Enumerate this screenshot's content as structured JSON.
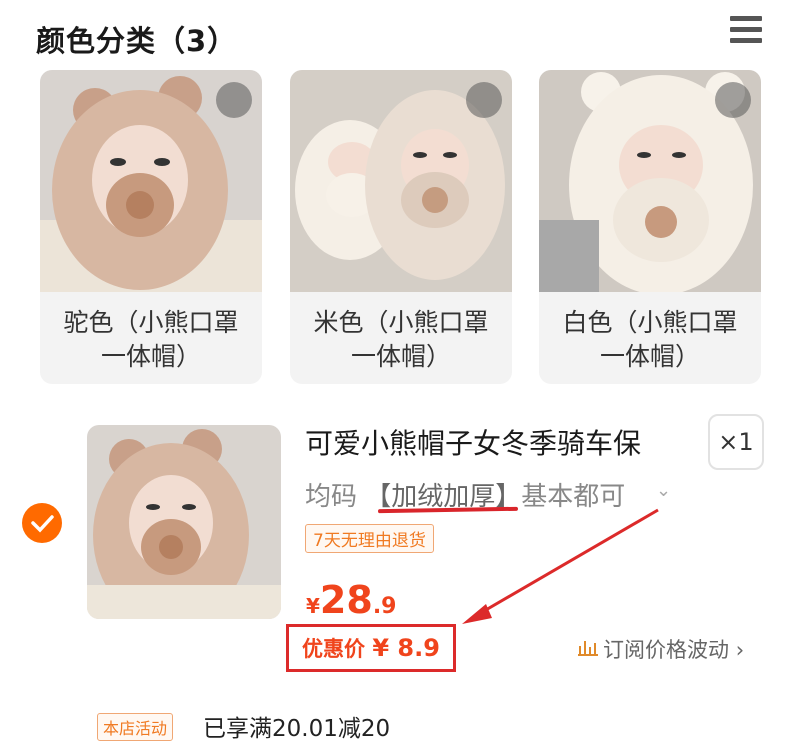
{
  "header": {
    "title": "颜色分类（3）",
    "menu_icon": "list-view-icon"
  },
  "variants": [
    {
      "label_line1": "驼色（小熊口罩",
      "label_line2": "一体帽）",
      "hat_color": "#d7b7a2"
    },
    {
      "label_line1": "米色（小熊口罩",
      "label_line2": "一体帽）",
      "hat_color": "#e9ddd2"
    },
    {
      "label_line1": "白色（小熊口罩",
      "label_line2": "一体帽）",
      "hat_color": "#f5efe6"
    }
  ],
  "cart_item": {
    "selected": true,
    "title": "可爱小熊帽子女冬季骑车保",
    "quantity": "×1",
    "spec_prefix": "均码",
    "spec_highlight": "【加绒加厚】",
    "spec_suffix": "基本都可",
    "return_policy": "7天无理由退货",
    "price_symbol": "¥",
    "price_integer": "28",
    "price_fraction": ".9",
    "discount_label": "优惠价",
    "discount_amount": "¥ 8.9",
    "subscribe_label": "订阅价格波动",
    "promo_tag": "本店活动",
    "promo_text": "已享满20.01减20"
  },
  "colors": {
    "accent": "#ff6a00",
    "price": "#f0441c",
    "annotation": "#dc2a2a"
  }
}
